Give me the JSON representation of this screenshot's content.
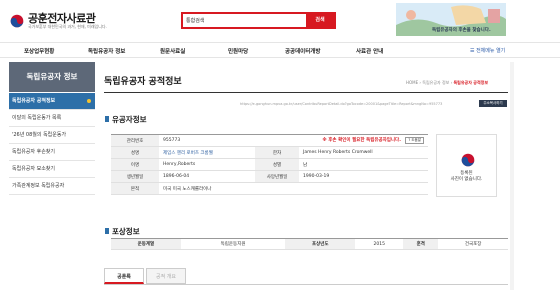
{
  "header": {
    "logo": "공훈전자사료관",
    "logo_sub": "국가보훈부 대한민국의 과거, 현재, 미래입니다.",
    "search": {
      "value": "통합검색",
      "button": "검색"
    },
    "banner_text": "독립유공자의 후손을 찾습니다."
  },
  "nav": {
    "items": [
      "포상업무현황",
      "독립유공자 정보",
      "원문사료실",
      "민원마당",
      "공공데이터개방",
      "사료관 안내"
    ],
    "all_menu": "전체메뉴 열기"
  },
  "sidebar": {
    "title": "독립유공자 정보",
    "items": [
      {
        "label": "독립유공자 공적정보"
      },
      {
        "label": "이달의 독립운동가 목록"
      },
      {
        "label": "'26년 08월의 독립운동가"
      },
      {
        "label": "독립유공자 후손찾기"
      },
      {
        "label": "독립유공자 묘소찾기"
      },
      {
        "label": "가족관계정보 독립유공자"
      }
    ]
  },
  "main": {
    "title": "독립유공자 공적정보",
    "breadcrumb": {
      "home": "HOME",
      "sep": " › ",
      "mid": "독립유공자 정보",
      "current": "독립유공자 공적정보"
    },
    "url": "https://e-gonghun.mpva.go.kr/user/ContribuReportDetail.do?goTocode=20001&pageTitle=Report&mngNo=955773",
    "url_button": "주소복사하기"
  },
  "info": {
    "section_title": "유공자정보",
    "mgmt_no_label": "관리번호",
    "mgmt_no": "955773",
    "notice": "※ 후손 확인이 필요한 독립유공자입니다.",
    "notice_button": "도움말",
    "name_label": "성명",
    "name": "제임스 헨리 로버츠 크롬웰",
    "hanja_label": "한자",
    "hanja": "James Henry Roberts Cromwell",
    "alias_label": "이명",
    "alias": "Henry,Roberts",
    "sex_label": "성별",
    "sex": "남",
    "birth_label": "생년월일",
    "birth": "1896-06-04",
    "death_label": "사망년월일",
    "death": "1990-03-19",
    "origin_label": "본적",
    "origin": "미국 미국 노스캐롤라이나",
    "photo_text": "등록된\n사진이 없습니다."
  },
  "compensation": {
    "section_title": "포상정보",
    "headers": {
      "movement": "운동계열",
      "year": "포상년도",
      "grade": "훈격"
    },
    "values": {
      "movement": "독립운동지원",
      "year": "2015",
      "grade": "건국포장"
    }
  },
  "tabs": [
    "공훈록",
    "공적 개요"
  ],
  "colors": {
    "accent_red": "#d71921",
    "sidebar_blue": "#2d6fa8",
    "sidebar_head": "#5d6878"
  }
}
